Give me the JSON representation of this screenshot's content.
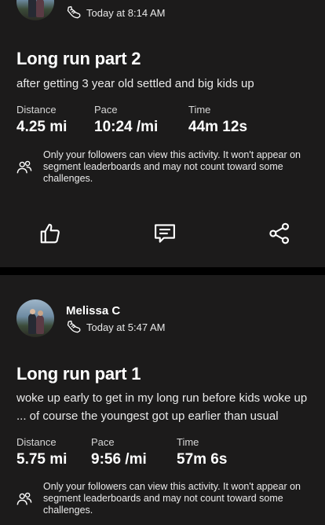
{
  "activities": [
    {
      "time_label": "Today at 8:14 AM",
      "title": "Long run part 2",
      "description": "after getting 3 year old settled and big kids up",
      "stats": [
        {
          "label": "Distance",
          "value": "4.25 mi"
        },
        {
          "label": "Pace",
          "value": "10:24 /mi"
        },
        {
          "label": "Time",
          "value": "44m 12s"
        }
      ],
      "privacy_note": "Only your followers can view this activity. It won't appear on segment leaderboards and may not count toward some challenges.",
      "actions": {
        "kudos_icon": "thumbs-up-icon",
        "comment_icon": "comment-icon",
        "share_icon": "share-icon"
      }
    },
    {
      "athlete_name": "Melissa C",
      "time_label": "Today at 5:47 AM",
      "title": "Long run part 1",
      "description": "woke up early to get in my long run before kids woke up ... of course the youngest got up earlier than usual",
      "stats": [
        {
          "label": "Distance",
          "value": "5.75 mi"
        },
        {
          "label": "Pace",
          "value": "9:56 /mi"
        },
        {
          "label": "Time",
          "value": "57m 6s"
        }
      ],
      "privacy_note": "Only your followers can view this activity. It won't appear on segment leaderboards and may not count toward some challenges."
    }
  ],
  "colors": {
    "card_bg": "#1c1b1b",
    "separator": "#000000",
    "text": "#ffffff"
  }
}
